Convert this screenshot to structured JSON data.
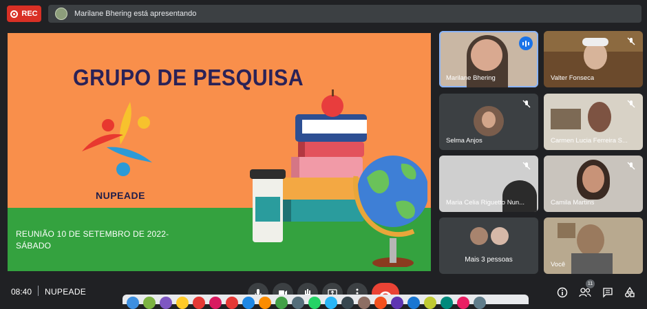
{
  "top_bar": {
    "rec_label": "REC",
    "presenting_text": "Marilane Bhering está apresentando"
  },
  "slide": {
    "title": "GRUPO DE PESQUISA",
    "logo_text": "NUPEADE",
    "meeting_line1": "REUNIÃO  10  DE SETEMBRO DE  2022-",
    "meeting_line2": "SÁBADO",
    "colors": {
      "background": "#f98f4b",
      "ground": "#34a23f",
      "title": "#2b2257"
    }
  },
  "participants": [
    {
      "name": "Marilane Bhering",
      "speaking": true
    },
    {
      "name": "Valter Fonseca",
      "muted": true
    },
    {
      "name": "Selma Anjos",
      "muted": true
    },
    {
      "name": "Carmen Lucia Ferreira S...",
      "muted": true
    },
    {
      "name": "Maria Celia Riguetto Nun...",
      "muted": true
    },
    {
      "name": "Camila Martins",
      "muted": true
    },
    {
      "name": "",
      "more_label": "Mais 3 pessoas"
    },
    {
      "name": "Você"
    }
  ],
  "bottom_bar": {
    "time": "08:40",
    "separator": "|",
    "meeting_name": "NUPEADE",
    "participants_count": "11"
  },
  "icons": [
    "mic-icon",
    "camera-icon",
    "raise-hand-icon",
    "present-icon",
    "more-icon",
    "end-call-icon",
    "info-icon",
    "people-icon",
    "chat-icon",
    "activities-icon"
  ]
}
